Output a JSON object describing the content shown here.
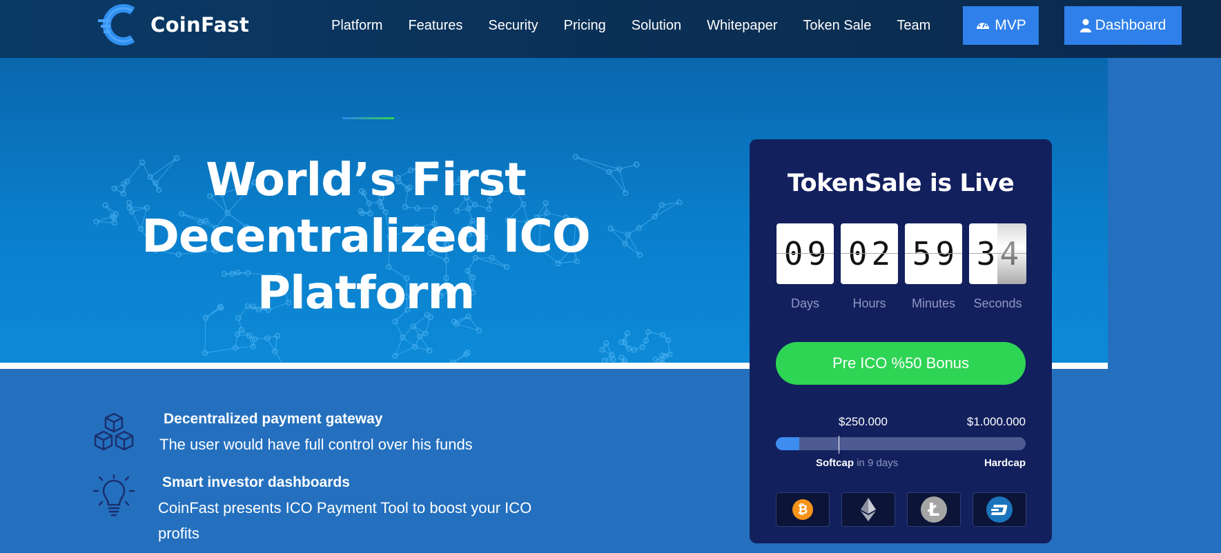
{
  "brand": {
    "name": "CoinFast",
    "accent": "#2f80ea",
    "green": "#2ed454"
  },
  "nav": {
    "items": [
      "Platform",
      "Features",
      "Security",
      "Pricing",
      "Solution",
      "Whitepaper",
      "Token Sale",
      "Team"
    ],
    "mvp_label": "MVP",
    "dashboard_label": "Dashboard"
  },
  "hero": {
    "headline": [
      "World’s First",
      "Decentralized ICO",
      "Platform"
    ]
  },
  "features": [
    {
      "icon": "blocks-icon",
      "title": "Decentralized payment gateway",
      "desc": [
        "The user would have full control over his funds"
      ]
    },
    {
      "icon": "lightbulb-icon",
      "title": "Smart investor dashboards",
      "desc": [
        "CoinFast presents ICO Payment Tool to boost your ICO",
        "profits"
      ]
    }
  ],
  "token_sale": {
    "title": "TokenSale is Live",
    "countdown": [
      {
        "value": "09",
        "label": "Days"
      },
      {
        "value": "02",
        "label": "Hours"
      },
      {
        "value": "59",
        "label": "Minutes"
      },
      {
        "value": "34",
        "label": "Seconds"
      }
    ],
    "bonus_button": "Pre ICO %50 Bonus",
    "softcap_amount": "$250.000",
    "hardcap_amount": "$1.000.000",
    "softcap_label": "Softcap",
    "softcap_note": "in 9 days",
    "hardcap_label": "Hardcap",
    "progress_fraction": 0.095,
    "softcap_fraction": 0.25,
    "coins": [
      "bitcoin-icon",
      "ethereum-icon",
      "litecoin-icon",
      "dash-icon"
    ]
  }
}
